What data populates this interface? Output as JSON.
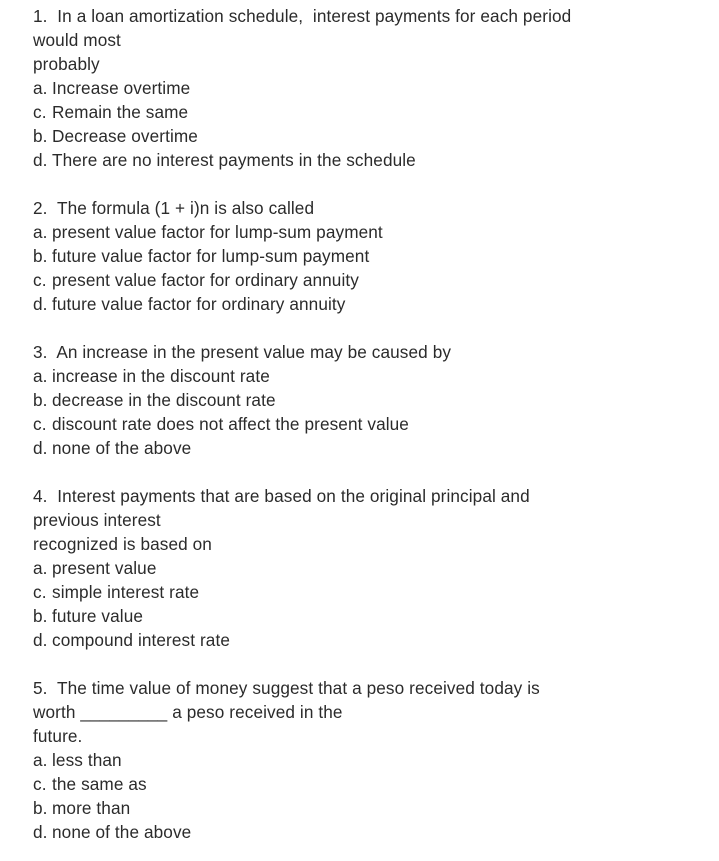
{
  "document": {
    "background_color": "#ffffff",
    "text_color": "#2b2b2b",
    "questions": [
      {
        "number": "1.",
        "stem_lines": [
          "1.  In a loan amortization schedule,  interest payments for each period",
          "would most",
          "probably"
        ],
        "options": [
          {
            "letter": "a.",
            "text": "Increase overtime"
          },
          {
            "letter": "c.",
            "text": "Remain the same"
          },
          {
            "letter": "b.",
            "text": "Decrease overtime"
          },
          {
            "letter": "d.",
            "text": "There are no interest payments in the schedule"
          }
        ]
      },
      {
        "number": "2.",
        "stem_lines": [
          "2.  The formula (1 + i)n is also called"
        ],
        "options": [
          {
            "letter": "a.",
            "text": "present value factor for lump-sum payment"
          },
          {
            "letter": "b.",
            "text": "future value factor for lump-sum payment"
          },
          {
            "letter": "c.",
            "text": "present value factor for ordinary annuity"
          },
          {
            "letter": "d.",
            "text": "future value factor for ordinary annuity"
          }
        ]
      },
      {
        "number": "3.",
        "stem_lines": [
          "3.  An increase in the present value may be caused by"
        ],
        "options": [
          {
            "letter": "a.",
            "text": "increase in the discount rate"
          },
          {
            "letter": "b.",
            "text": "decrease in the discount rate"
          },
          {
            "letter": "c.",
            "text": "discount rate does not affect the present value"
          },
          {
            "letter": "d.",
            "text": "none of the above"
          }
        ]
      },
      {
        "number": "4.",
        "stem_lines": [
          "4.  Interest payments that are based on the original principal and",
          "previous interest",
          "recognized is based on"
        ],
        "options": [
          {
            "letter": "a.",
            "text": "present value"
          },
          {
            "letter": "c.",
            "text": "simple interest rate"
          },
          {
            "letter": "b.",
            "text": "future value"
          },
          {
            "letter": "d.",
            "text": "compound interest rate"
          }
        ]
      },
      {
        "number": "5.",
        "stem_lines": [
          "5.  The time value of money suggest that a peso received today is",
          "worth _________ a peso received in the",
          "future."
        ],
        "options": [
          {
            "letter": "a.",
            "text": "less than"
          },
          {
            "letter": "c.",
            "text": "the same as"
          },
          {
            "letter": "b.",
            "text": "more than"
          },
          {
            "letter": "d.",
            "text": "none of the above"
          }
        ]
      }
    ]
  }
}
